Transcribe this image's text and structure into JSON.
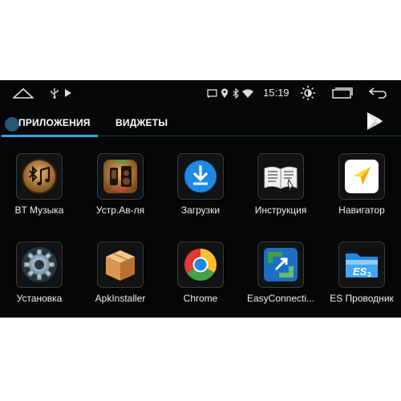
{
  "statusbar": {
    "time": "15:19",
    "icons": [
      "home-icon",
      "usb-icon",
      "play-icon",
      "cast-icon",
      "location-icon",
      "bluetooth-icon",
      "wifi-icon",
      "brightness-icon",
      "recents-icon",
      "back-icon"
    ]
  },
  "tabs": {
    "apps": "ПРИЛОЖЕНИЯ",
    "widgets": "ВИДЖЕТЫ"
  },
  "apps": [
    {
      "label": "BT Музыка",
      "icon": "bt-music-icon"
    },
    {
      "label": "Устр.Ав-ля",
      "icon": "car-device-icon"
    },
    {
      "label": "Загрузки",
      "icon": "download-icon"
    },
    {
      "label": "Инструкция",
      "icon": "book-icon"
    },
    {
      "label": "Навигатор",
      "icon": "navigator-icon"
    },
    {
      "label": "Установка",
      "icon": "settings-icon"
    },
    {
      "label": "ApkInstaller",
      "icon": "package-icon"
    },
    {
      "label": "Chrome",
      "icon": "chrome-icon"
    },
    {
      "label": "EasyConnecti...",
      "icon": "easyconnect-icon"
    },
    {
      "label": "ES Проводник",
      "icon": "es-folder-icon"
    }
  ],
  "colors": {
    "background": "#050607",
    "accent": "#33a7e0"
  }
}
